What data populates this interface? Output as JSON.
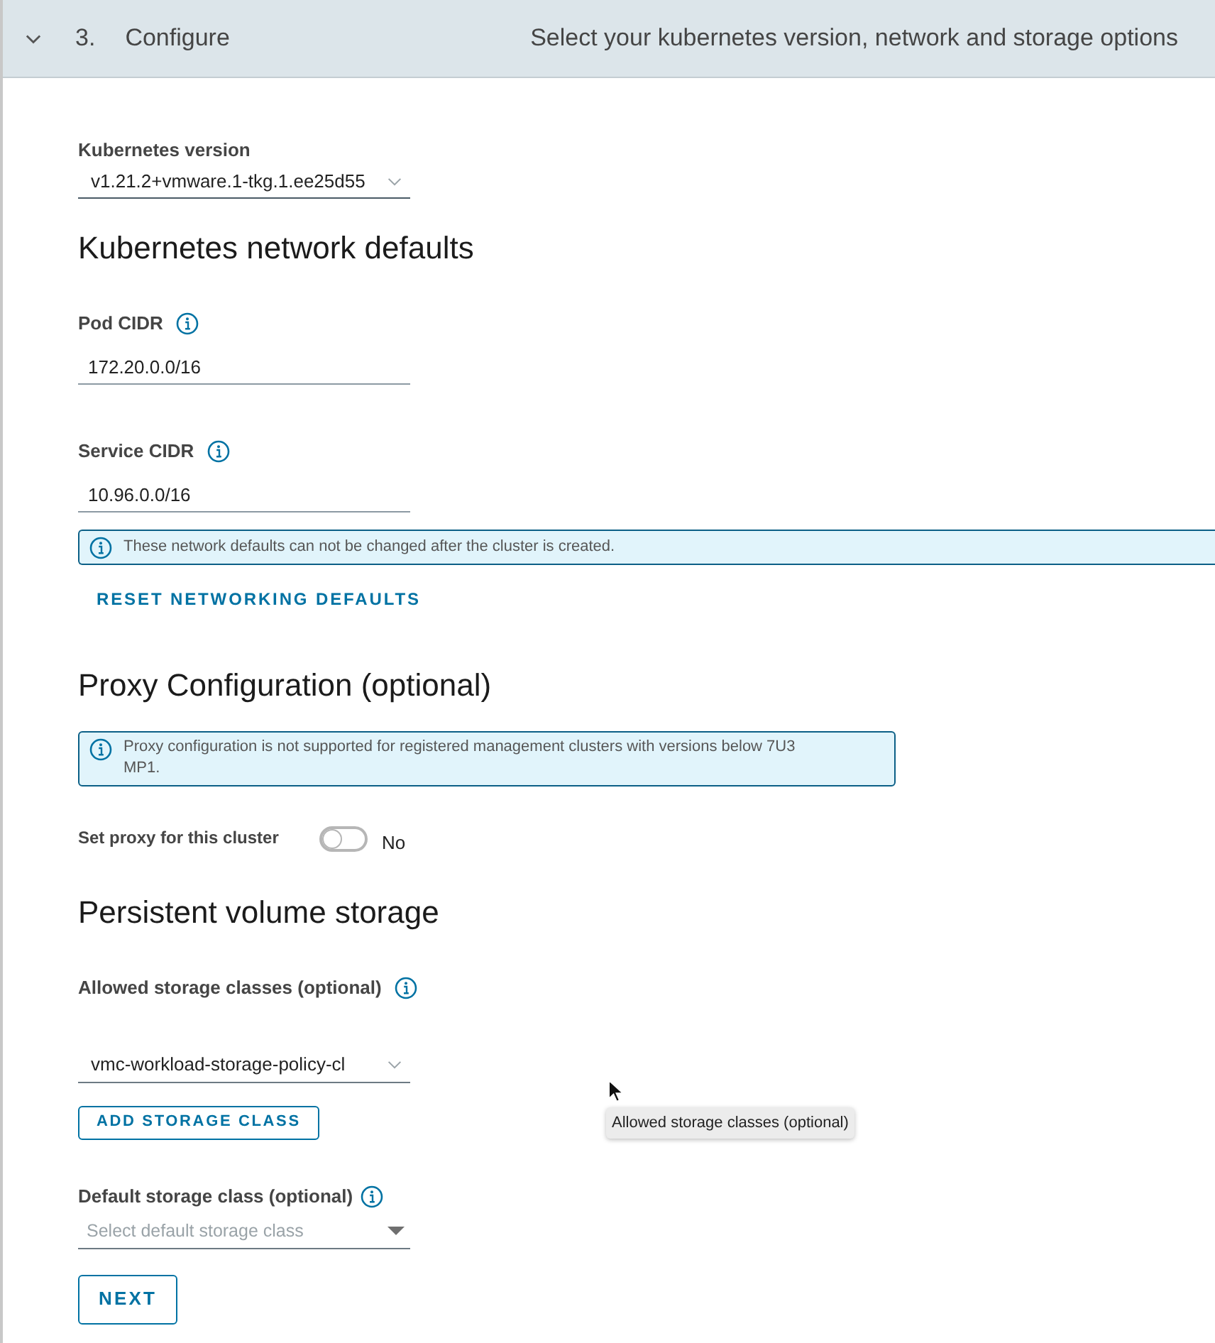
{
  "step_header": {
    "expanded": true,
    "number": "3.",
    "title": "Configure",
    "description": "Select your kubernetes version, network and storage options"
  },
  "kubernetes_version": {
    "label": "Kubernetes version",
    "value": "v1.21.2+vmware.1-tkg.1.ee25d55"
  },
  "network": {
    "heading": "Kubernetes network defaults",
    "fields": [
      {
        "label": "Pod CIDR",
        "value": "172.20.0.0/16"
      },
      {
        "label": "Service CIDR",
        "value": "10.96.0.0/16"
      }
    ],
    "alert": "These network defaults can not be changed after the cluster is created.",
    "reset_button": "RESET NETWORKING DEFAULTS"
  },
  "proxy": {
    "heading": "Proxy Configuration (optional)",
    "alert": "Proxy configuration is not supported for registered management clusters with versions below 7U3 MP1.",
    "toggle": {
      "label": "Set proxy for this cluster",
      "on": false,
      "state_text": "No"
    }
  },
  "storage": {
    "heading": "Persistent volume storage",
    "allowed_classes": {
      "label": "Allowed storage classes (optional)",
      "value": "vmc-workload-storage-policy-cl"
    },
    "add_button": "ADD STORAGE CLASS",
    "default_class": {
      "label": "Default storage class (optional)",
      "placeholder": "Select default storage class"
    }
  },
  "next_button": "NEXT",
  "tooltip": "Allowed storage classes (optional)"
}
